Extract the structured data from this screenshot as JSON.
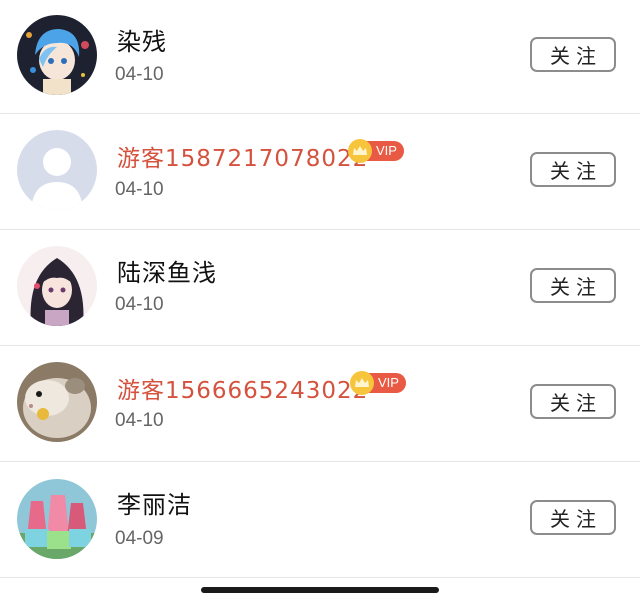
{
  "follow_list": [
    {
      "name": "染残",
      "date": "04-10",
      "vip": false,
      "button": "关注",
      "avatar": "anime-girl-blue-hair-avatar"
    },
    {
      "name": "游客1587217078022",
      "date": "04-10",
      "vip": true,
      "vip_label": "VIP",
      "button": "关注",
      "avatar": "default-user-avatar"
    },
    {
      "name": "陆深鱼浅",
      "date": "04-10",
      "vip": false,
      "button": "关注",
      "avatar": "anime-girl-dark-hair-avatar"
    },
    {
      "name": "游客1566665243022",
      "date": "04-10",
      "vip": true,
      "vip_label": "VIP",
      "button": "关注",
      "avatar": "hamster-avatar"
    },
    {
      "name": "李丽洁",
      "date": "04-09",
      "vip": false,
      "button": "关注",
      "avatar": "gift-boxes-avatar"
    }
  ],
  "colors": {
    "vip_name": "#d4523e",
    "vip_badge": "#e95a44",
    "vip_crown": "#f7c53b",
    "button_border": "#8c8c8c"
  }
}
